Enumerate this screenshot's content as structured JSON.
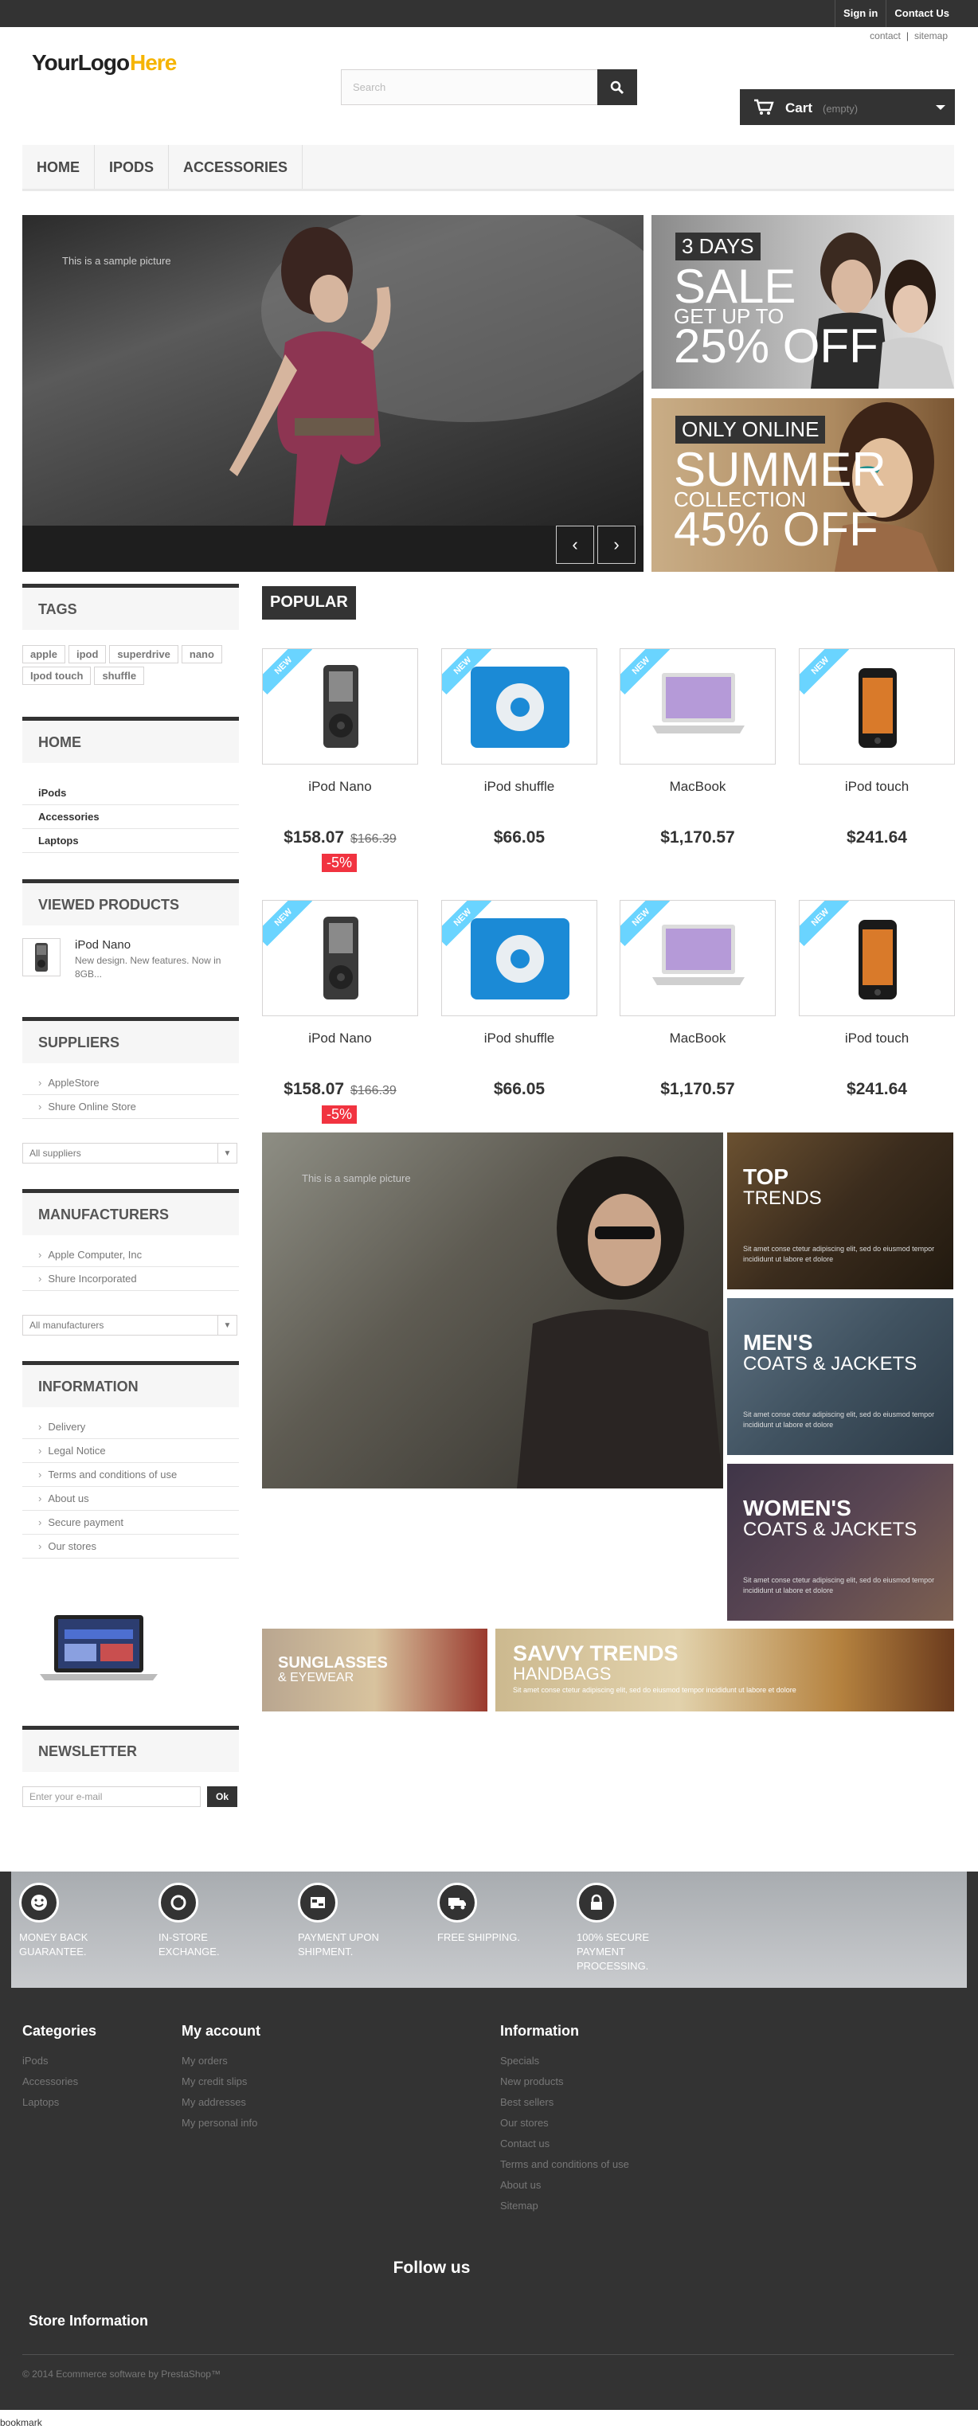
{
  "topbar": {
    "signin": "Sign in",
    "contact": "Contact Us"
  },
  "toplinks": {
    "contact": "contact",
    "sitemap": "sitemap"
  },
  "logo": {
    "text": "YourLogoHere"
  },
  "search": {
    "placeholder": "Search"
  },
  "cart": {
    "label": "Cart",
    "status": "(empty)"
  },
  "menu": [
    "HOME",
    "IPODS",
    "ACCESSORIES"
  ],
  "slider": {
    "caption": "This is a sample picture"
  },
  "promos": [
    {
      "badge": "3 DAYS",
      "line1": "SALE",
      "line2": "GET UP TO",
      "line3": "25% OFF"
    },
    {
      "badge": "ONLY ONLINE",
      "line1": "SUMMER",
      "line2": "COLLECTION",
      "line3": "45% OFF"
    }
  ],
  "sidebar": {
    "tags_title": "TAGS",
    "tags": [
      "apple",
      "ipod",
      "superdrive",
      "nano",
      "Ipod touch",
      "shuffle"
    ],
    "home_title": "HOME",
    "categories": [
      "iPods",
      "Accessories",
      "Laptops"
    ],
    "viewed_title": "VIEWED PRODUCTS",
    "viewed": {
      "name": "iPod Nano",
      "desc": "New design. New features. Now in 8GB..."
    },
    "suppliers_title": "SUPPLIERS",
    "suppliers": [
      "AppleStore",
      "Shure Online Store"
    ],
    "suppliers_select": "All suppliers",
    "manufacturers_title": "MANUFACTURERS",
    "manufacturers": [
      "Apple Computer, Inc",
      "Shure Incorporated"
    ],
    "manufacturers_select": "All manufacturers",
    "information_title": "INFORMATION",
    "information": [
      "Delivery",
      "Legal Notice",
      "Terms and conditions of use",
      "About us",
      "Secure payment",
      "Our stores"
    ],
    "newsletter_title": "NEWSLETTER",
    "newsletter_placeholder": "Enter your e-mail",
    "newsletter_button": "Ok"
  },
  "popular": {
    "tab": "POPULAR",
    "new_label": "NEW",
    "products": [
      {
        "name": "iPod Nano",
        "price": "$158.07",
        "old": "$166.39",
        "discount": "-5%"
      },
      {
        "name": "iPod shuffle",
        "price": "$66.05",
        "old": "",
        "discount": ""
      },
      {
        "name": "MacBook",
        "price": "$1,170.57",
        "old": "",
        "discount": ""
      },
      {
        "name": "iPod touch",
        "price": "$241.64",
        "old": "",
        "discount": ""
      }
    ]
  },
  "banners": {
    "big_caption": "This is a sample picture",
    "side": [
      {
        "t1": "TOP",
        "t2": "TRENDS",
        "text": "Sit amet conse ctetur adipiscing elit, sed do eiusmod tempor incididunt ut labore et dolore"
      },
      {
        "t1": "MEN'S",
        "t2": "COATS & JACKETS",
        "text": "Sit amet conse ctetur adipiscing elit, sed do eiusmod tempor incididunt ut labore et dolore"
      },
      {
        "t1": "WOMEN'S",
        "t2": "COATS & JACKETS",
        "text": "Sit amet conse ctetur adipiscing elit, sed do eiusmod tempor incididunt ut labore et dolore"
      }
    ],
    "wide1": {
      "t1": "SUNGLASSES",
      "t2": "& EYEWEAR"
    },
    "wide2": {
      "t1": "SAVVY TRENDS",
      "t2": "HANDBAGS",
      "text": "Sit amet conse ctetur adipiscing elit, sed do eiusmod tempor incididunt ut labore et dolore"
    }
  },
  "reassurance": [
    {
      "label": "MONEY BACK GUARANTEE."
    },
    {
      "label": "IN-STORE EXCHANGE."
    },
    {
      "label": "PAYMENT UPON SHIPMENT."
    },
    {
      "label": "FREE SHIPPING."
    },
    {
      "label": "100% SECURE PAYMENT PROCESSING."
    }
  ],
  "footer": {
    "categories_title": "Categories",
    "categories": [
      "iPods",
      "Accessories",
      "Laptops"
    ],
    "account_title": "My account",
    "account": [
      "My orders",
      "My credit slips",
      "My addresses",
      "My personal info"
    ],
    "info_title": "Information",
    "info": [
      "Specials",
      "New products",
      "Best sellers",
      "Our stores",
      "Contact us",
      "Terms and conditions of use",
      "About us",
      "Sitemap"
    ],
    "follow": "Follow us",
    "store": "Store Information",
    "copyright": "© 2014 Ecommerce software by PrestaShop™"
  },
  "bookmark": "bookmark",
  "colors": {
    "dark": "#333333",
    "accent_new": "#6ad4ff",
    "discount": "#f13340"
  }
}
